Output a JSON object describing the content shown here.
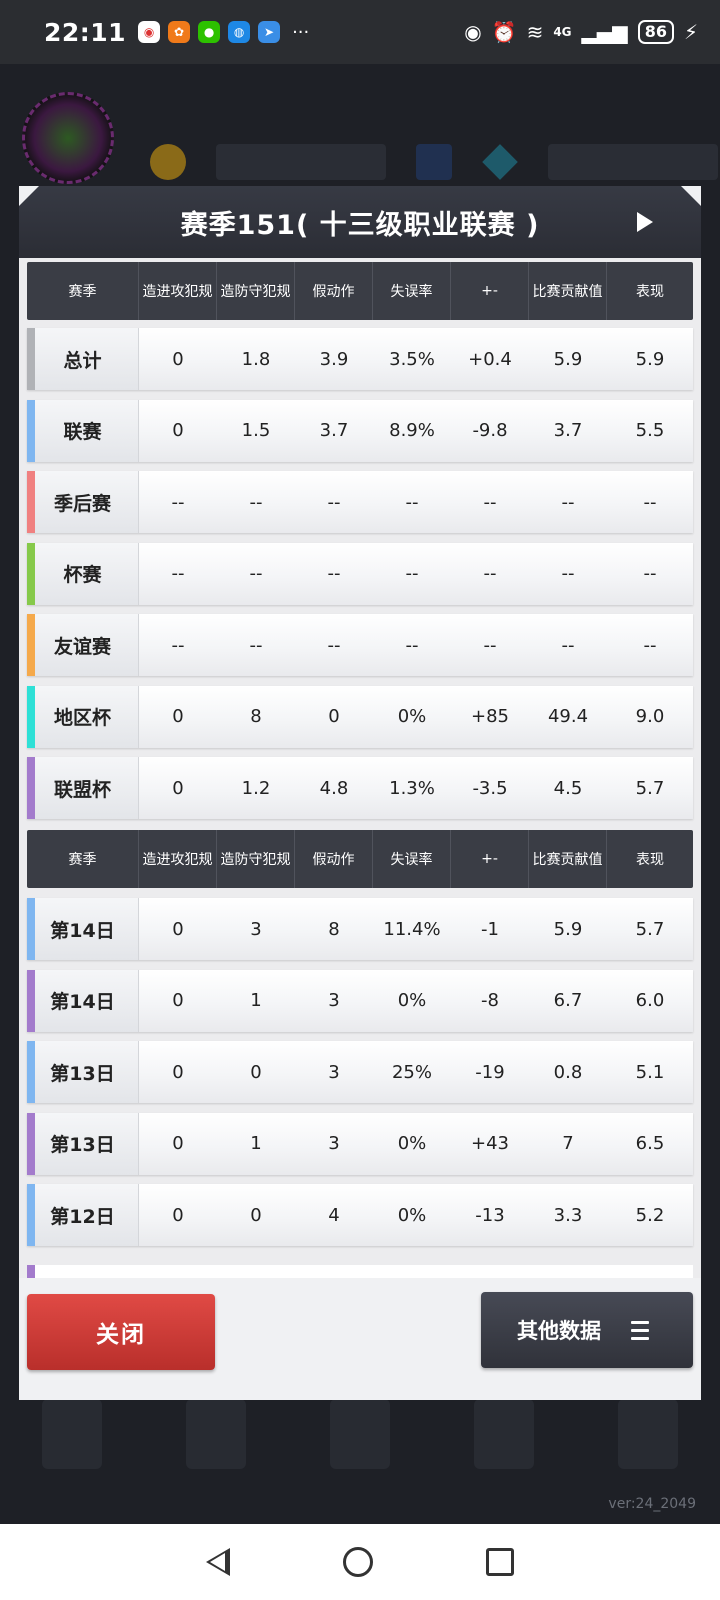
{
  "status_bar": {
    "time": "22:11",
    "more": "···",
    "network": "4G",
    "battery": "86"
  },
  "dialog": {
    "title": "赛季151( 十三级职业联赛 )",
    "columns": [
      "赛季",
      "造进攻犯规",
      "造防守犯规",
      "假动作",
      "失误率",
      "+-",
      "比赛贡献值",
      "表现"
    ],
    "season_rows": [
      {
        "label": "总计",
        "color": "#b0b2b6",
        "values": [
          "0",
          "1.8",
          "3.9",
          "3.5%",
          "+0.4",
          "5.9",
          "5.9"
        ]
      },
      {
        "label": "联赛",
        "color": "#7fb6f0",
        "values": [
          "0",
          "1.5",
          "3.7",
          "8.9%",
          "-9.8",
          "3.7",
          "5.5"
        ]
      },
      {
        "label": "季后赛",
        "color": "#f08080",
        "values": [
          "--",
          "--",
          "--",
          "--",
          "--",
          "--",
          "--"
        ]
      },
      {
        "label": "杯赛",
        "color": "#86c94a",
        "values": [
          "--",
          "--",
          "--",
          "--",
          "--",
          "--",
          "--"
        ]
      },
      {
        "label": "友谊赛",
        "color": "#f5a94b",
        "values": [
          "--",
          "--",
          "--",
          "--",
          "--",
          "--",
          "--"
        ]
      },
      {
        "label": "地区杯",
        "color": "#2ee0d6",
        "values": [
          "0",
          "8",
          "0",
          "0%",
          "+85",
          "49.4",
          "9.0"
        ]
      },
      {
        "label": "联盟杯",
        "color": "#a37bcc",
        "values": [
          "0",
          "1.2",
          "4.8",
          "1.3%",
          "-3.5",
          "4.5",
          "5.7"
        ]
      }
    ],
    "game_rows": [
      {
        "label": "第14日",
        "color": "#7fb6f0",
        "values": [
          "0",
          "3",
          "8",
          "11.4%",
          "-1",
          "5.9",
          "5.7"
        ]
      },
      {
        "label": "第14日",
        "color": "#a37bcc",
        "values": [
          "0",
          "1",
          "3",
          "0%",
          "-8",
          "6.7",
          "6.0"
        ]
      },
      {
        "label": "第13日",
        "color": "#7fb6f0",
        "values": [
          "0",
          "0",
          "3",
          "25%",
          "-19",
          "0.8",
          "5.1"
        ]
      },
      {
        "label": "第13日",
        "color": "#a37bcc",
        "values": [
          "0",
          "1",
          "3",
          "0%",
          "+43",
          "7",
          "6.5"
        ]
      },
      {
        "label": "第12日",
        "color": "#7fb6f0",
        "values": [
          "0",
          "0",
          "4",
          "0%",
          "-13",
          "3.3",
          "5.2"
        ]
      }
    ],
    "close_label": "关闭",
    "other_label": "其他数据"
  },
  "background": {
    "version": "ver:24_2049"
  },
  "icons": {
    "play": "play-icon",
    "menu": "menu-icon",
    "back": "back-icon",
    "home": "home-icon",
    "recent": "recents-icon"
  }
}
